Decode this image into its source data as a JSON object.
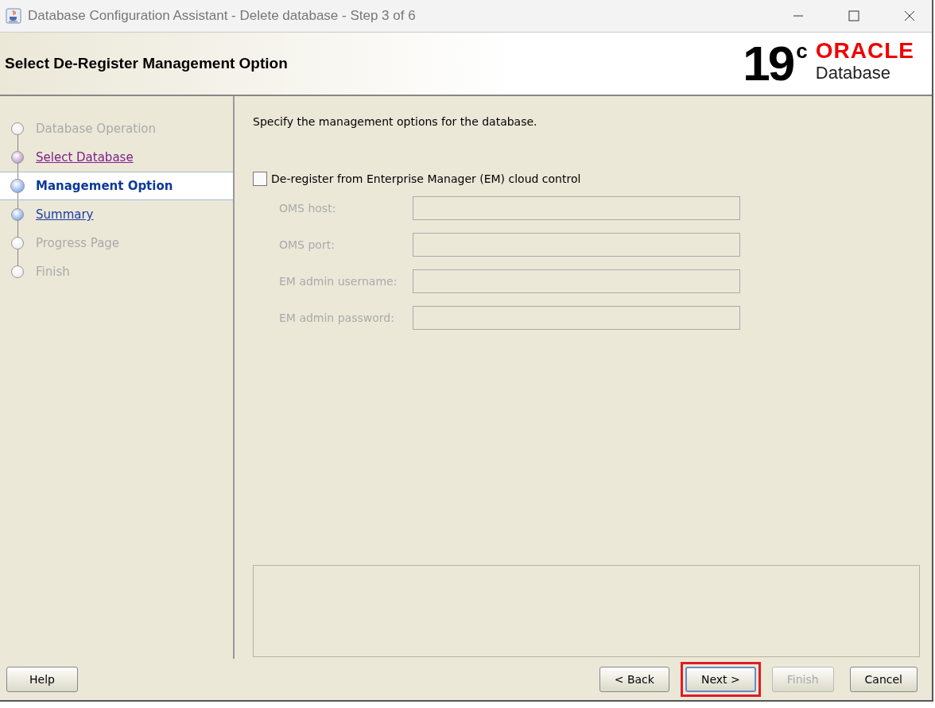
{
  "window": {
    "title": "Database Configuration Assistant - Delete database - Step 3 of 6"
  },
  "header": {
    "title": "Select De-Register Management Option",
    "logo": {
      "version": "19",
      "superscript": "c",
      "brand": "ORACLE",
      "product": "Database"
    }
  },
  "steps": [
    {
      "label": "Database Operation",
      "kind": "disabled",
      "selected": false
    },
    {
      "label": "Select Database",
      "kind": "visited",
      "selected": false
    },
    {
      "label": "Management Option",
      "kind": "current",
      "selected": true
    },
    {
      "label": "Summary",
      "kind": "link",
      "selected": false
    },
    {
      "label": "Progress Page",
      "kind": "disabled",
      "selected": false
    },
    {
      "label": "Finish",
      "kind": "disabled",
      "selected": false
    }
  ],
  "content": {
    "intro": "Specify the management options for the database.",
    "checkbox": {
      "label": "De-register from Enterprise Manager (EM) cloud control",
      "checked": false
    },
    "fields": [
      {
        "label": "OMS host:",
        "disabled": true
      },
      {
        "label": "OMS port:",
        "disabled": true
      },
      {
        "label": "EM admin username:",
        "disabled": true
      },
      {
        "label": "EM admin password:",
        "disabled": true
      }
    ]
  },
  "buttons": {
    "help": {
      "label": "Help",
      "disabled": false
    },
    "nav": [
      {
        "label": "< Back",
        "disabled": false,
        "highlighted": false
      },
      {
        "label": "Next >",
        "disabled": false,
        "highlighted": true
      },
      {
        "label": "Finish",
        "disabled": true,
        "highlighted": false
      },
      {
        "label": "Cancel",
        "disabled": false,
        "highlighted": false
      }
    ]
  }
}
